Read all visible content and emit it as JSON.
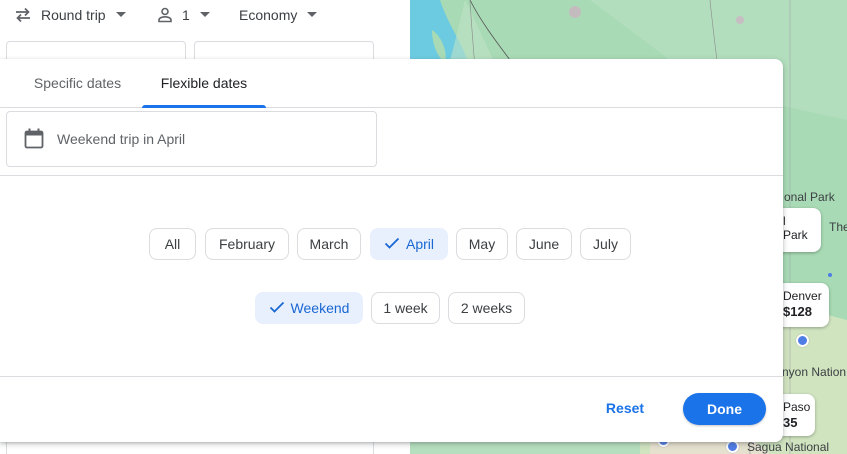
{
  "search_bar": {
    "trip_type": "Round trip",
    "passengers": "1",
    "cabin_class": "Economy",
    "icons": {
      "trip": "swap-arrows-icon",
      "passenger": "person-icon",
      "dropdown": "caret-down-icon"
    }
  },
  "map": {
    "labels": [
      "onal Park",
      "The",
      "nyon Nation",
      "Sagua",
      "National"
    ],
    "cards": [
      {
        "name": "l Park",
        "price": ""
      },
      {
        "name": "Denver",
        "price": "$128"
      },
      {
        "name": "Paso",
        "price": "35"
      }
    ]
  },
  "date_picker": {
    "tabs": [
      {
        "label": "Specific dates",
        "selected": false
      },
      {
        "label": "Flexible dates",
        "selected": true
      }
    ],
    "summary": "Weekend trip in April",
    "months": [
      {
        "label": "All",
        "selected": false
      },
      {
        "label": "February",
        "selected": false
      },
      {
        "label": "March",
        "selected": false
      },
      {
        "label": "April",
        "selected": true
      },
      {
        "label": "May",
        "selected": false
      },
      {
        "label": "June",
        "selected": false
      },
      {
        "label": "July",
        "selected": false
      }
    ],
    "durations": [
      {
        "label": "Weekend",
        "selected": true
      },
      {
        "label": "1 week",
        "selected": false
      },
      {
        "label": "2 weeks",
        "selected": false
      }
    ],
    "reset_label": "Reset",
    "done_label": "Done"
  },
  "colors": {
    "accent": "#1a73e8",
    "selected_chip_bg": "#e8f0fe",
    "selected_chip_text": "#1967d2",
    "map_land": "#a8dab5",
    "map_water": "#6ccbe0"
  }
}
